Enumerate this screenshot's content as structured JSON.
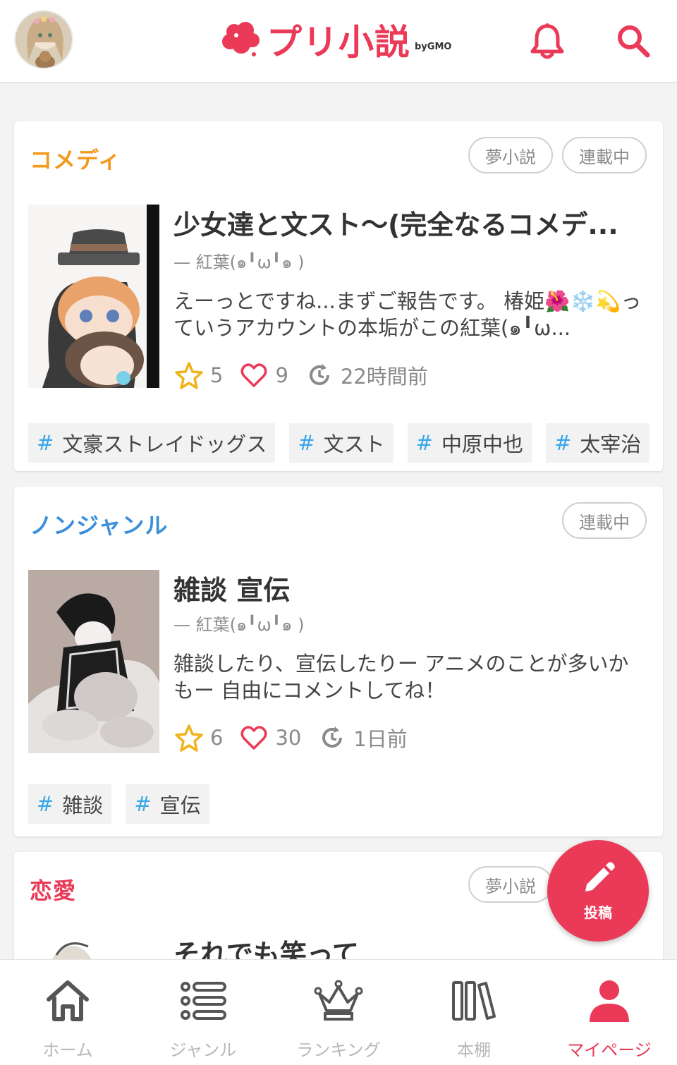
{
  "app": {
    "logo_text": "プリ小説",
    "logo_by": "byGMO"
  },
  "colors": {
    "brand": "#ea3a58",
    "comedy": "#f39a1e",
    "nongenre": "#3b8fd9",
    "romance": "#ea3a58",
    "tag_hash": "#3aa6e8"
  },
  "header": {
    "avatar_icon": "user-avatar",
    "notification_icon": "bell-icon",
    "search_icon": "search-icon"
  },
  "cards": [
    {
      "genre": "コメディ",
      "badges": [
        "夢小説",
        "連載中"
      ],
      "title": "少女達と文スト～(完全なるコメデ...",
      "author": "— 紅葉(๑╹ω╹๑ )",
      "description": "えーっとですね...まずご報告です。 椿姫🌺❄️💫っていうアカウントの本垢がこの紅葉(๑╹ω...",
      "stars": "5",
      "likes": "9",
      "updated": "22時間前",
      "tags": [
        "文豪ストレイドッグス",
        "文スト",
        "中原中也",
        "太宰治"
      ]
    },
    {
      "genre": "ノンジャンル",
      "badges": [
        "連載中"
      ],
      "title": "雑談 宣伝",
      "author": "— 紅葉(๑╹ω╹๑ )",
      "description": "雑談したり、宣伝したりー アニメのことが多いかもー 自由にコメントしてね！",
      "stars": "6",
      "likes": "30",
      "updated": "1日前",
      "tags": [
        "雑談",
        "宣伝"
      ]
    },
    {
      "genre": "恋愛",
      "badges": [
        "夢小説"
      ],
      "title": "それでも笑って"
    }
  ],
  "fab": {
    "label": "投稿",
    "icon": "pencil-icon"
  },
  "bottom_nav": [
    {
      "label": "ホーム",
      "icon": "home-icon"
    },
    {
      "label": "ジャンル",
      "icon": "list-icon"
    },
    {
      "label": "ランキング",
      "icon": "crown-icon"
    },
    {
      "label": "本棚",
      "icon": "bookshelf-icon"
    },
    {
      "label": "マイページ",
      "icon": "person-icon",
      "active": true
    }
  ]
}
